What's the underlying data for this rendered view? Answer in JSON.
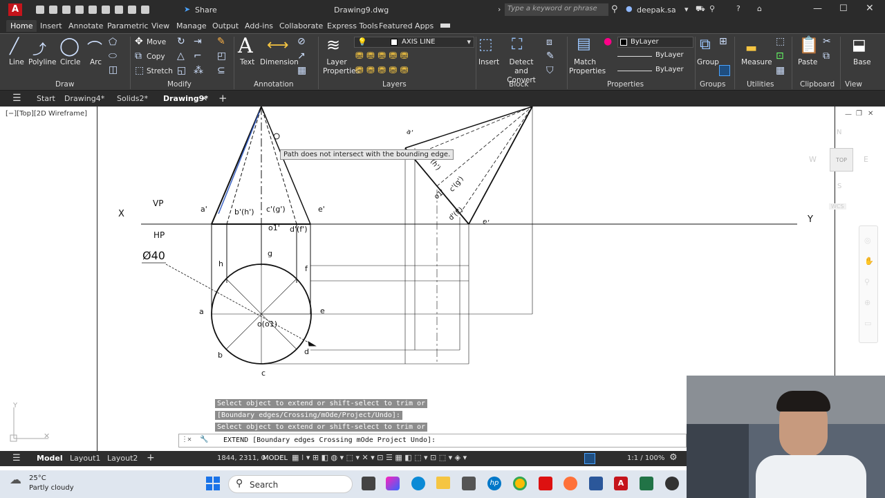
{
  "app": {
    "title": "Drawing9.dwg",
    "share_label": "Share",
    "search_placeholder": "Type a keyword or phrase",
    "user": "deepak.sa",
    "ribbon_tabs": [
      "Home",
      "Insert",
      "Annotate",
      "Parametric",
      "View",
      "Manage",
      "Output",
      "Add-ins",
      "Collaborate",
      "Express Tools",
      "Featured Apps"
    ]
  },
  "ribbon": {
    "draw": {
      "title": "Draw",
      "line": "Line",
      "polyline": "Polyline",
      "circle": "Circle",
      "arc": "Arc"
    },
    "modify": {
      "title": "Modify",
      "move": "Move",
      "copy": "Copy",
      "stretch": "Stretch"
    },
    "annotation": {
      "title": "Annotation",
      "text": "Text",
      "dimension": "Dimension"
    },
    "layers": {
      "title": "Layers",
      "layer_properties": "Layer Properties",
      "current_layer": "AXIS LINE"
    },
    "block": {
      "title": "Block",
      "insert": "Insert",
      "detect": "Detect and Convert"
    },
    "properties": {
      "title": "Properties",
      "match": "Match Properties",
      "color": "ByLayer",
      "linetype": "ByLayer",
      "lineweight": "ByLayer"
    },
    "groups": {
      "title": "Groups",
      "group": "Group"
    },
    "utilities": {
      "title": "Utilities",
      "measure": "Measure"
    },
    "clipboard": {
      "title": "Clipboard",
      "paste": "Paste"
    },
    "view": {
      "title": "View",
      "base": "Base"
    }
  },
  "file_tabs": [
    "Start",
    "Drawing4*",
    "Solids2*",
    "Drawing9*"
  ],
  "viewport": {
    "label": "[−][Top][2D Wireframe]",
    "tooltip": "Path does not intersect with the bounding edge.",
    "viewcube": {
      "top": "TOP",
      "n": "N",
      "s": "S",
      "e": "E",
      "w": "W",
      "wcs": "WCS"
    },
    "drawing_labels": {
      "x": "X",
      "y": "Y",
      "vp": "VP",
      "hp": "HP",
      "dia": "Ø40",
      "a_p": "a'",
      "bh_p": "b'(h')",
      "cg_p": "c'(g')",
      "e_p": "e'",
      "o1_p": "o1'",
      "df_p": "d'(f')",
      "h": "h",
      "g": "g",
      "f": "f",
      "a": "a",
      "e": "e",
      "b": "b",
      "d": "d",
      "c": "c",
      "o": "o(o1)",
      "side_a": "a'",
      "side_h": "(h')",
      "side_cg": "c'(g')",
      "side_o1": "o1'",
      "side_df": "d'(f')",
      "side_e": "e'"
    }
  },
  "command": {
    "history": [
      "Select object to extend or shift-select to trim or",
      "[Boundary edges/Crossing/mOde/Project/Undo]:",
      "Select object to extend or shift-select to trim or"
    ],
    "prompt": "EXTEND [Boundary edges Crossing mOde Project Undo]:"
  },
  "status": {
    "layouts": [
      "Model",
      "Layout1",
      "Layout2"
    ],
    "coords": "1844, 2311, 0",
    "space": "MODEL",
    "scale": "1:1 / 100%"
  },
  "taskbar": {
    "weather_temp": "25°C",
    "weather_desc": "Partly cloudy",
    "search": "Search"
  }
}
